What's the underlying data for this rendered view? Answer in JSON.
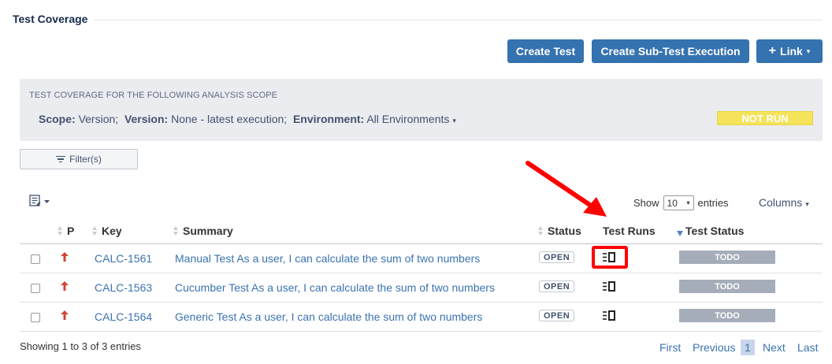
{
  "section": {
    "title": "Test Coverage"
  },
  "toolbar": {
    "create_test": "Create Test",
    "create_sub_test_execution": "Create Sub-Test Execution",
    "link_plus": "+",
    "link_label": "Link",
    "link_caret": "▾",
    "accent_color": "#3572b0"
  },
  "scope": {
    "heading": "Test Coverage for the following analysis scope",
    "scope_label": "Scope:",
    "scope_value": "Version;",
    "version_label": "Version:",
    "version_value": "None - latest execution;",
    "environment_label": "Environment:",
    "environment_value": "All Environments",
    "environment_caret": "▾",
    "overall_status": "NOT RUN",
    "overall_status_color": "#f4e35b"
  },
  "filter": {
    "label": "Filter(s)",
    "icon": "filter-icon"
  },
  "table_controls": {
    "show_label": "Show",
    "entries_value": "10",
    "entries_caret": "▾",
    "entries_label": "entries",
    "columns_label": "Columns",
    "columns_caret": "▾"
  },
  "table": {
    "headers": {
      "priority": "P",
      "key": "Key",
      "summary": "Summary",
      "status": "Status",
      "test_runs": "Test Runs",
      "test_status": "Test Status"
    },
    "rows": [
      {
        "priority_icon": "priority-major-icon",
        "key": "CALC-1561",
        "summary": "Manual Test As a user, I can calculate the sum of two numbers",
        "status": "OPEN",
        "test_status": "TODO"
      },
      {
        "priority_icon": "priority-major-icon",
        "key": "CALC-1563",
        "summary": "Cucumber Test As a user, I can calculate the sum of two numbers",
        "status": "OPEN",
        "test_status": "TODO"
      },
      {
        "priority_icon": "priority-major-icon",
        "key": "CALC-1564",
        "summary": "Generic Test As a user, I can calculate the sum of two numbers",
        "status": "OPEN",
        "test_status": "TODO"
      }
    ],
    "test_status_color": "#a5adba",
    "priority_color": "#d04437"
  },
  "footer": {
    "info": "Showing 1 to 3 of 3 entries",
    "first": "First",
    "previous": "Previous",
    "current_page": "1",
    "next": "Next",
    "last": "Last"
  },
  "annotation": {
    "color": "#ff0000"
  }
}
